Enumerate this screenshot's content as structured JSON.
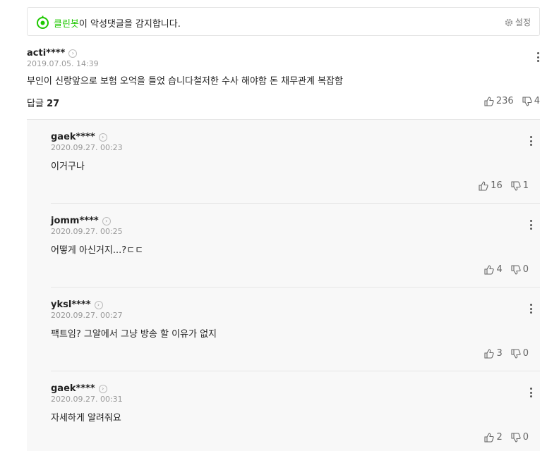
{
  "cleanbot": {
    "brand": "클린봇",
    "message": "이 악성댓글을 감지합니다.",
    "settings_label": "설정"
  },
  "main_comment": {
    "user": "acti****",
    "date": "2019.07.05. 14:39",
    "text": "부인이 신랑앞으로 보험 오억을 들었 습니다철저한 수사 해야함 돈 채무관계 복잡함",
    "likes": "236",
    "dislikes": "4",
    "replies_label": "답글",
    "replies_count": "27"
  },
  "replies": [
    {
      "user": "gaek****",
      "date": "2020.09.27. 00:23",
      "text": "이거구나",
      "likes": "16",
      "dislikes": "1"
    },
    {
      "user": "jomm****",
      "date": "2020.09.27. 00:25",
      "text": "어떻게 아신거지...?ㄷㄷ",
      "likes": "4",
      "dislikes": "0"
    },
    {
      "user": "yksl****",
      "date": "2020.09.27. 00:27",
      "text": "팩트임? 그알에서 그냥 방송 할 이유가 없지",
      "likes": "3",
      "dislikes": "0"
    },
    {
      "user": "gaek****",
      "date": "2020.09.27. 00:31",
      "text": "자세하게 알려줘요",
      "likes": "2",
      "dislikes": "0"
    }
  ],
  "colors": {
    "brand_green": "#1ec800",
    "reply_bg": "#f8f8f8"
  },
  "icons": [
    "cleanbot-icon",
    "gear-icon",
    "profile-arrow-icon",
    "more-menu-icon",
    "thumbs-up-icon",
    "thumbs-down-icon"
  ]
}
